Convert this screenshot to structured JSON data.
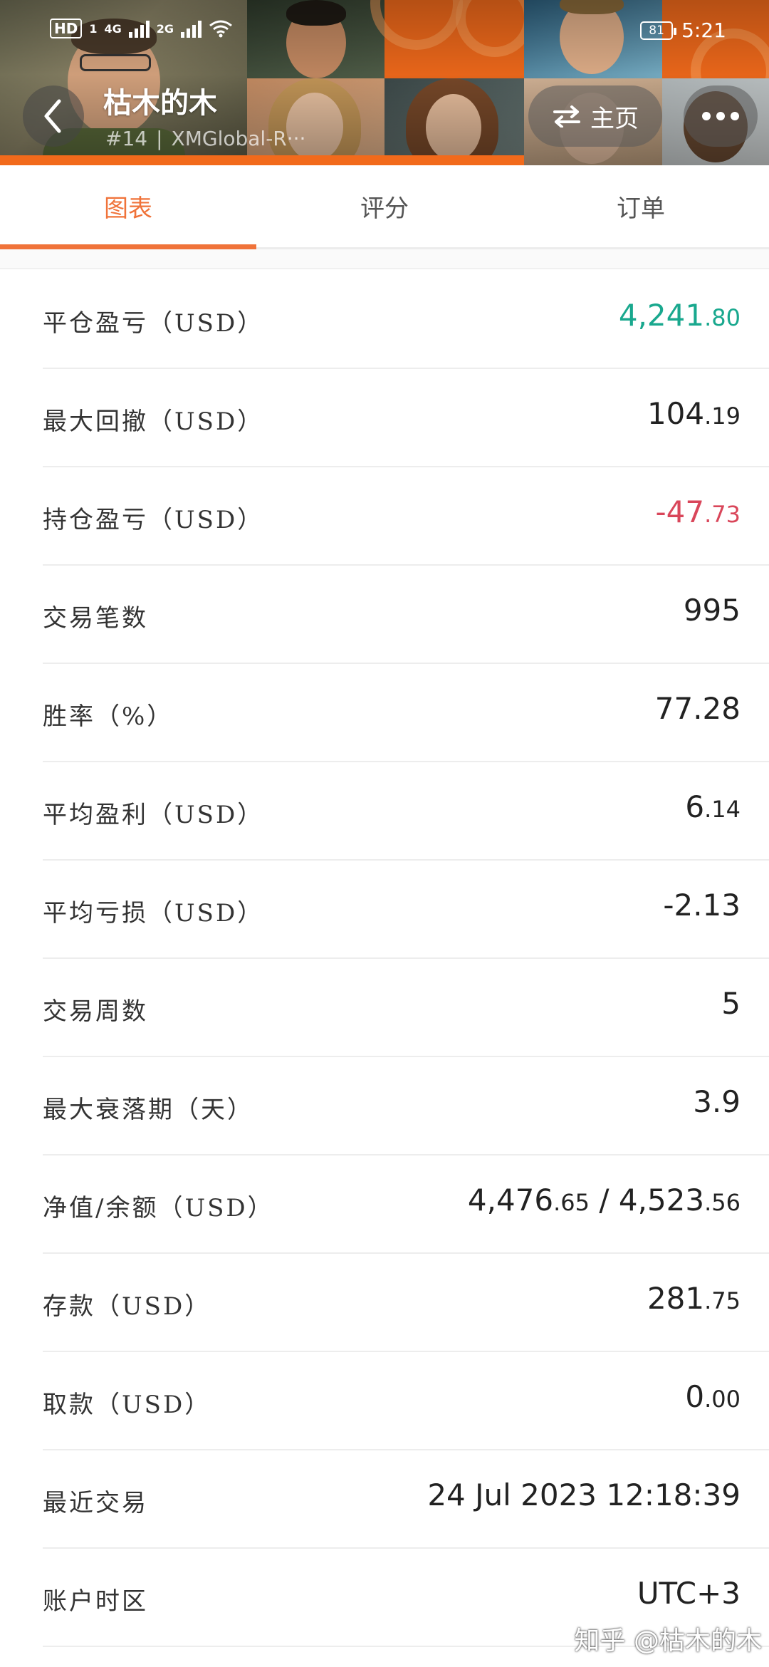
{
  "status_bar": {
    "hd_label": "HD",
    "sim_label": "1",
    "network_1": "4G",
    "network_2": "2G",
    "battery": "81",
    "time": "5:21"
  },
  "header": {
    "user_name": "枯木的木",
    "rank": "#14",
    "broker": "XMGlobal-R···",
    "home_label": "主页",
    "accent_color": "#f26a1b"
  },
  "tabs": [
    {
      "label": "图表",
      "active": true
    },
    {
      "label": "评分",
      "active": false
    },
    {
      "label": "订单",
      "active": false
    }
  ],
  "stats": [
    {
      "label": "平仓盈亏（USD）",
      "int": "4,241",
      "dec": ".80",
      "color": "green"
    },
    {
      "label": "最大回撤（USD）",
      "int": "104",
      "dec": ".19",
      "color": ""
    },
    {
      "label": "持仓盈亏（USD）",
      "int": "-47",
      "dec": ".73",
      "color": "red"
    },
    {
      "label": "交易笔数",
      "int": "995",
      "dec": "",
      "color": ""
    },
    {
      "label": "胜率（%）",
      "int": "77.28",
      "dec": "",
      "color": ""
    },
    {
      "label": "平均盈利（USD）",
      "int": "6",
      "dec": ".14",
      "color": ""
    },
    {
      "label": "平均亏损（USD）",
      "int": "-2.13",
      "dec": "",
      "color": ""
    },
    {
      "label": "交易周数",
      "int": "5",
      "dec": "",
      "color": ""
    },
    {
      "label": "最大衰落期（天）",
      "int": "3.9",
      "dec": "",
      "color": ""
    },
    {
      "label": "净值/余额（USD）",
      "int": "4,476",
      "dec": ".65",
      "int2": " / 4,523",
      "dec2": ".56",
      "color": ""
    },
    {
      "label": "存款（USD）",
      "int": "281",
      "dec": ".75",
      "color": ""
    },
    {
      "label": "取款（USD）",
      "int": "0",
      "dec": ".00",
      "color": ""
    },
    {
      "label": "最近交易",
      "int": "24 Jul 2023 12:18:39",
      "dec": "",
      "color": ""
    },
    {
      "label": "账户时区",
      "int": "UTC+3",
      "dec": "",
      "color": ""
    }
  ],
  "watermark": "知乎 @枯木的木",
  "colors": {
    "positive": "#19a88e",
    "negative": "#d9465a",
    "tab_active": "#f0733a"
  }
}
